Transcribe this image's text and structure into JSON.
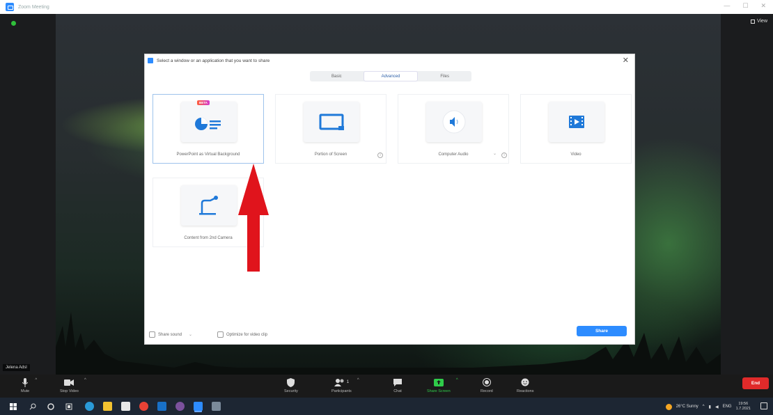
{
  "window": {
    "title": "Zoom Meeting",
    "controls": [
      "—",
      "☐",
      "✕"
    ]
  },
  "video": {
    "view_label": "View",
    "participant_name": "Jelena Adsl"
  },
  "dialog": {
    "title": "Select a window or an application that you want to share",
    "close": "✕",
    "tabs": [
      {
        "label": "Basic",
        "active": false
      },
      {
        "label": "Advanced",
        "active": true
      },
      {
        "label": "Files",
        "active": false
      }
    ],
    "options": [
      {
        "label": "PowerPoint as Virtual Background",
        "badge": "BETA",
        "selected": true,
        "icon": "powerpoint-bg-icon"
      },
      {
        "label": "Portion of Screen",
        "info": true,
        "icon": "portion-screen-icon"
      },
      {
        "label": "Computer Audio",
        "info": true,
        "dropdown": "⌄",
        "icon": "speaker-icon"
      },
      {
        "label": "Video",
        "icon": "video-file-icon"
      },
      {
        "label": "Content from 2nd Camera",
        "icon": "second-camera-icon"
      }
    ],
    "info_glyph": "i",
    "footer": {
      "share_sound": "Share sound",
      "share_sound_caret": "⌄",
      "optimize": "Optimize for video clip",
      "share_button": "Share"
    }
  },
  "annotation": {
    "arrow_color": "#e0141c"
  },
  "controls": {
    "mute": "Mute",
    "stop_video": "Stop Video",
    "security": "Security",
    "participants": "Participants",
    "participants_count": "1",
    "chat": "Chat",
    "share_screen": "Share Screen",
    "record": "Record",
    "reactions": "Reactions",
    "end": "End",
    "caret": "^"
  },
  "taskbar": {
    "weather": "26°C Sunny",
    "language": "ENG",
    "time": "19:56",
    "date": "1.7.2021"
  },
  "colors": {
    "accent": "#2d8cff",
    "share_screen_green": "#2fcc4a",
    "end_red": "#e02a2a"
  }
}
